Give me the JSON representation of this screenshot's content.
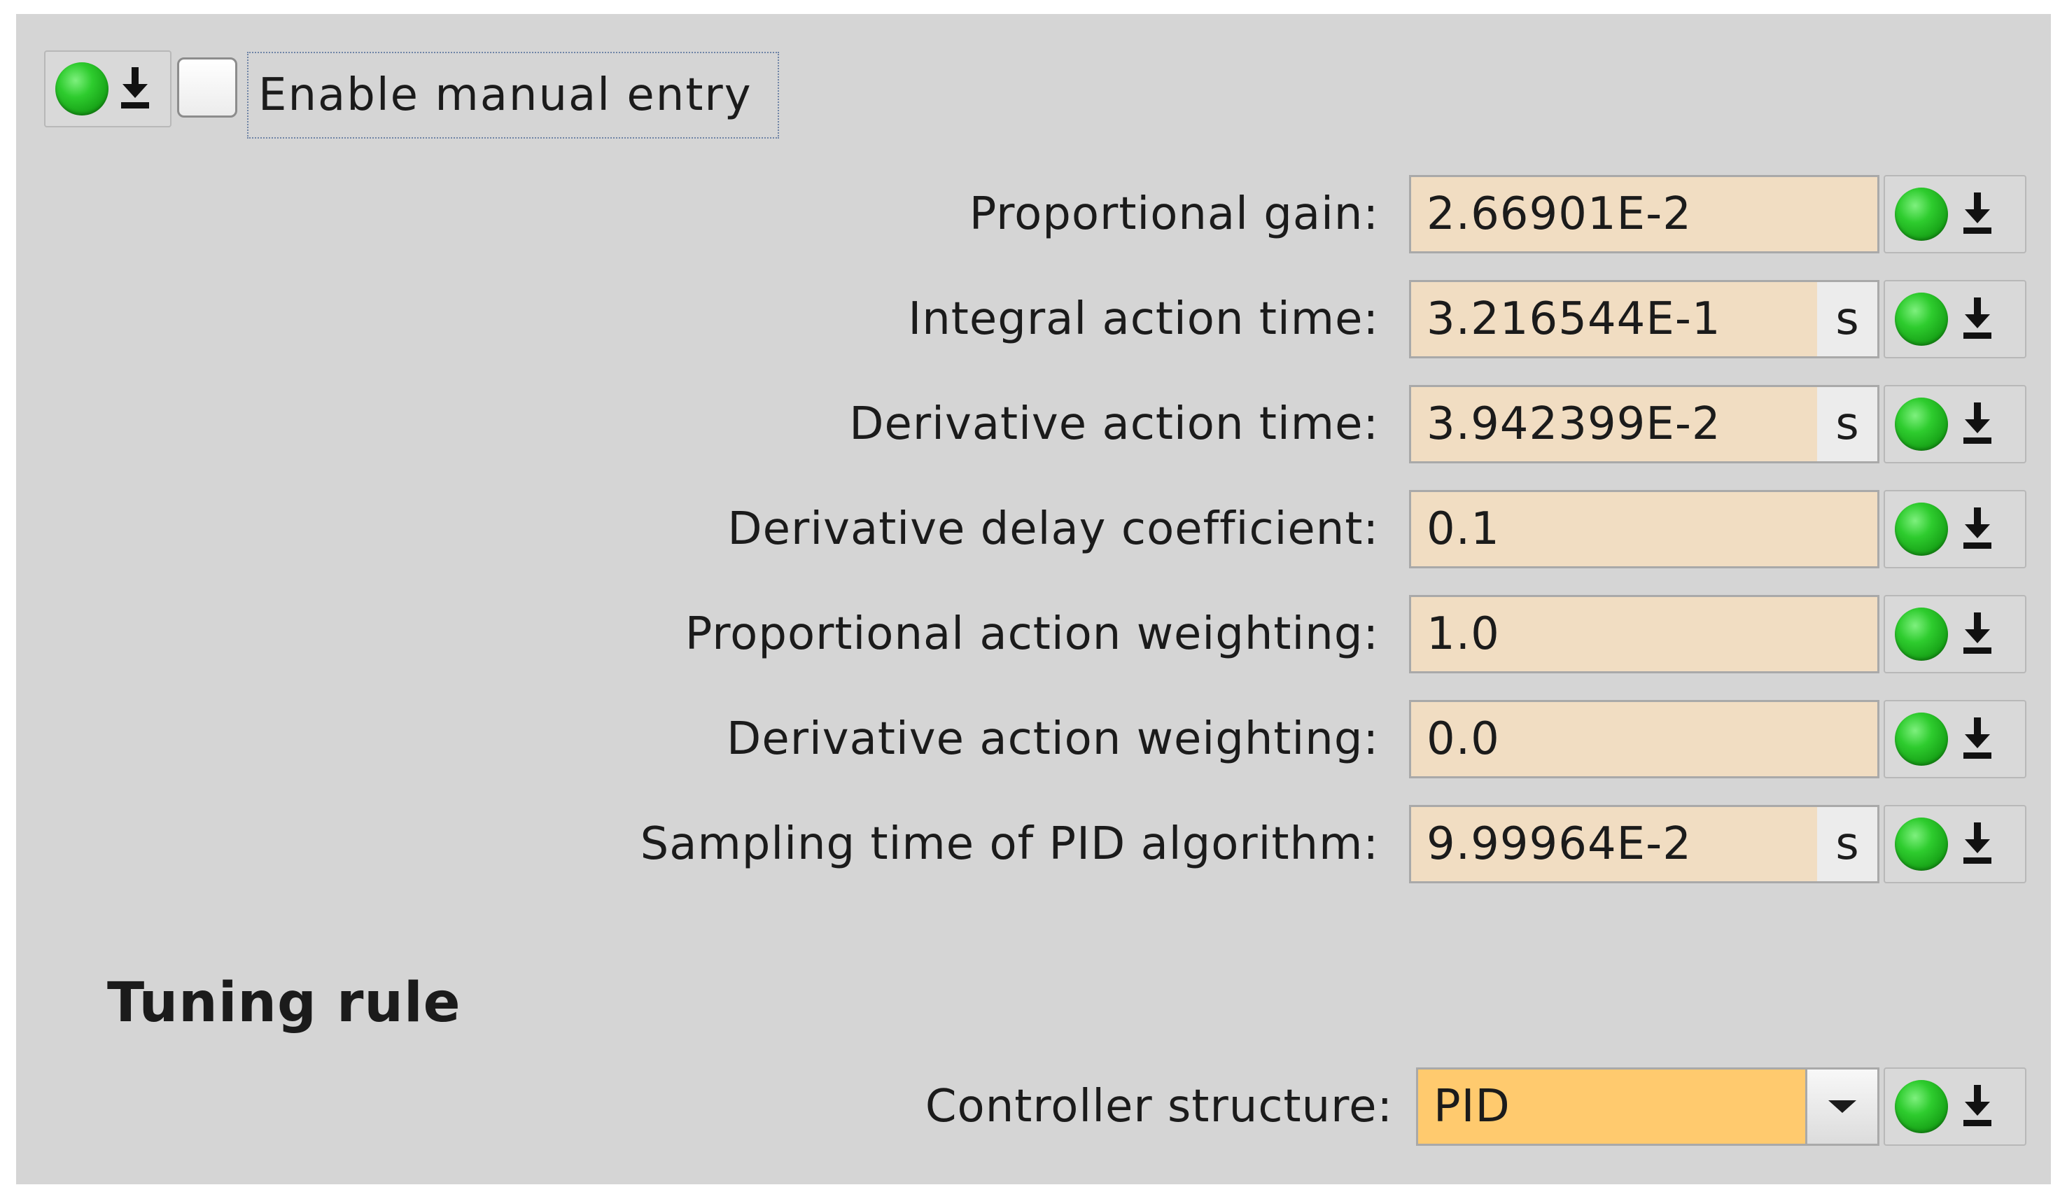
{
  "manual_entry": {
    "checkbox_label": "Enable manual entry",
    "checked": false
  },
  "parameters": [
    {
      "label": "Proportional gain:",
      "value": "2.66901E-2",
      "unit": ""
    },
    {
      "label": "Integral action time:",
      "value": "3.216544E-1",
      "unit": "s"
    },
    {
      "label": "Derivative action time:",
      "value": "3.942399E-2",
      "unit": "s"
    },
    {
      "label": "Derivative delay coefficient:",
      "value": "0.1",
      "unit": ""
    },
    {
      "label": "Proportional action weighting:",
      "value": "1.0",
      "unit": ""
    },
    {
      "label": "Derivative action weighting:",
      "value": "0.0",
      "unit": ""
    },
    {
      "label": "Sampling time of PID algorithm:",
      "value": "9.99964E-2",
      "unit": "s"
    }
  ],
  "tuning_rule": {
    "section_title": "Tuning rule",
    "controller_structure_label": "Controller structure:",
    "controller_structure_value": "PID"
  },
  "colors": {
    "panel_background": "#d5d5d5",
    "field_background": "#f1ddc2",
    "select_background": "#ffca6e",
    "status_led": "#2ecc2e"
  },
  "icons": {
    "status": "green-status-led-icon",
    "download": "download-to-device-icon",
    "dropdown": "chevron-down-icon"
  }
}
